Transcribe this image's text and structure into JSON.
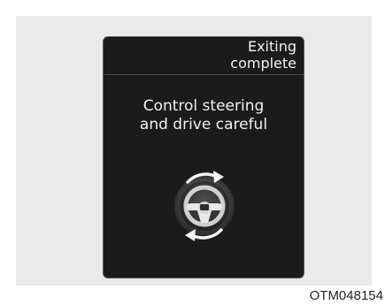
{
  "display": {
    "status_lines": [
      "Exiting",
      "complete"
    ],
    "message_lines": [
      "Control steering",
      "and drive careful"
    ],
    "icon": "steering-wheel-icon"
  },
  "caption": "OTM048154",
  "colors": {
    "screen_background": "#1b1b1b",
    "text": "#f2f2f2",
    "frame_background": "#eaeaea"
  }
}
